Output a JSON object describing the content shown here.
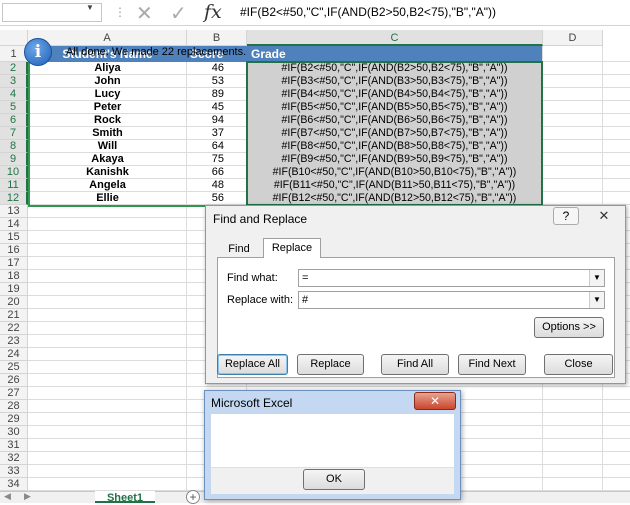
{
  "formula_bar": {
    "name_box_value": "",
    "formula": "#IF(B2<#50,\"C\",IF(AND(B2>50,B2<75),\"B\",\"A\"))",
    "fx": "fx",
    "cancel_icon": "✕",
    "enter_icon": "✓"
  },
  "columns": [
    "A",
    "B",
    "C",
    "D"
  ],
  "rows": [
    "1",
    "2",
    "3",
    "4",
    "5",
    "6",
    "7",
    "8",
    "9",
    "10",
    "11",
    "12",
    "13",
    "14",
    "15",
    "16",
    "17",
    "18",
    "19",
    "20",
    "21",
    "22",
    "23",
    "24",
    "25",
    "26",
    "27",
    "28",
    "29",
    "30",
    "31",
    "32",
    "33",
    "34"
  ],
  "headers": {
    "name": "Student's Name",
    "score": "Score",
    "grade": "Grade"
  },
  "students": [
    {
      "name": "Aliya",
      "score": "46",
      "grade": "#IF(B2<#50,\"C\",IF(AND(B2>50,B2<75),\"B\",\"A\"))"
    },
    {
      "name": "John",
      "score": "53",
      "grade": "#IF(B3<#50,\"C\",IF(AND(B3>50,B3<75),\"B\",\"A\"))"
    },
    {
      "name": "Lucy",
      "score": "89",
      "grade": "#IF(B4<#50,\"C\",IF(AND(B4>50,B4<75),\"B\",\"A\"))"
    },
    {
      "name": "Peter",
      "score": "45",
      "grade": "#IF(B5<#50,\"C\",IF(AND(B5>50,B5<75),\"B\",\"A\"))"
    },
    {
      "name": "Rock",
      "score": "94",
      "grade": "#IF(B6<#50,\"C\",IF(AND(B6>50,B6<75),\"B\",\"A\"))"
    },
    {
      "name": "Smith",
      "score": "37",
      "grade": "#IF(B7<#50,\"C\",IF(AND(B7>50,B7<75),\"B\",\"A\"))"
    },
    {
      "name": "Will",
      "score": "64",
      "grade": "#IF(B8<#50,\"C\",IF(AND(B8>50,B8<75),\"B\",\"A\"))"
    },
    {
      "name": "Akaya",
      "score": "75",
      "grade": "#IF(B9<#50,\"C\",IF(AND(B9>50,B9<75),\"B\",\"A\"))"
    },
    {
      "name": "Kanishk",
      "score": "66",
      "grade": "#IF(B10<#50,\"C\",IF(AND(B10>50,B10<75),\"B\",\"A\"))"
    },
    {
      "name": "Angela",
      "score": "48",
      "grade": "#IF(B11<#50,\"C\",IF(AND(B11>50,B11<75),\"B\",\"A\"))"
    },
    {
      "name": "Ellie",
      "score": "56",
      "grade": "#IF(B12<#50,\"C\",IF(AND(B12>50,B12<75),\"B\",\"A\"))"
    }
  ],
  "sheet_tabs": {
    "active": "Sheet1",
    "add": "+"
  },
  "find_replace": {
    "title": "Find and Replace",
    "help": "?",
    "close": "✕",
    "tab_find": "Find",
    "tab_replace": "Replace",
    "find_what_label": "Find what:",
    "find_what_value": "=",
    "replace_with_label": "Replace with:",
    "replace_with_value": "#",
    "options_btn": "Options >>",
    "replace_all_btn": "Replace All",
    "replace_btn": "Replace",
    "find_all_btn": "Find All",
    "find_next_btn": "Find Next",
    "close_btn": "Close"
  },
  "message_box": {
    "title": "Microsoft Excel",
    "close": "✕",
    "icon": "i",
    "message": "All done. We made 22 replacements.",
    "ok_btn": "OK"
  },
  "colors": {
    "header_fill": "#4f81bd",
    "selection_green": "#217346",
    "formula_fill": "#d0d0d0"
  }
}
